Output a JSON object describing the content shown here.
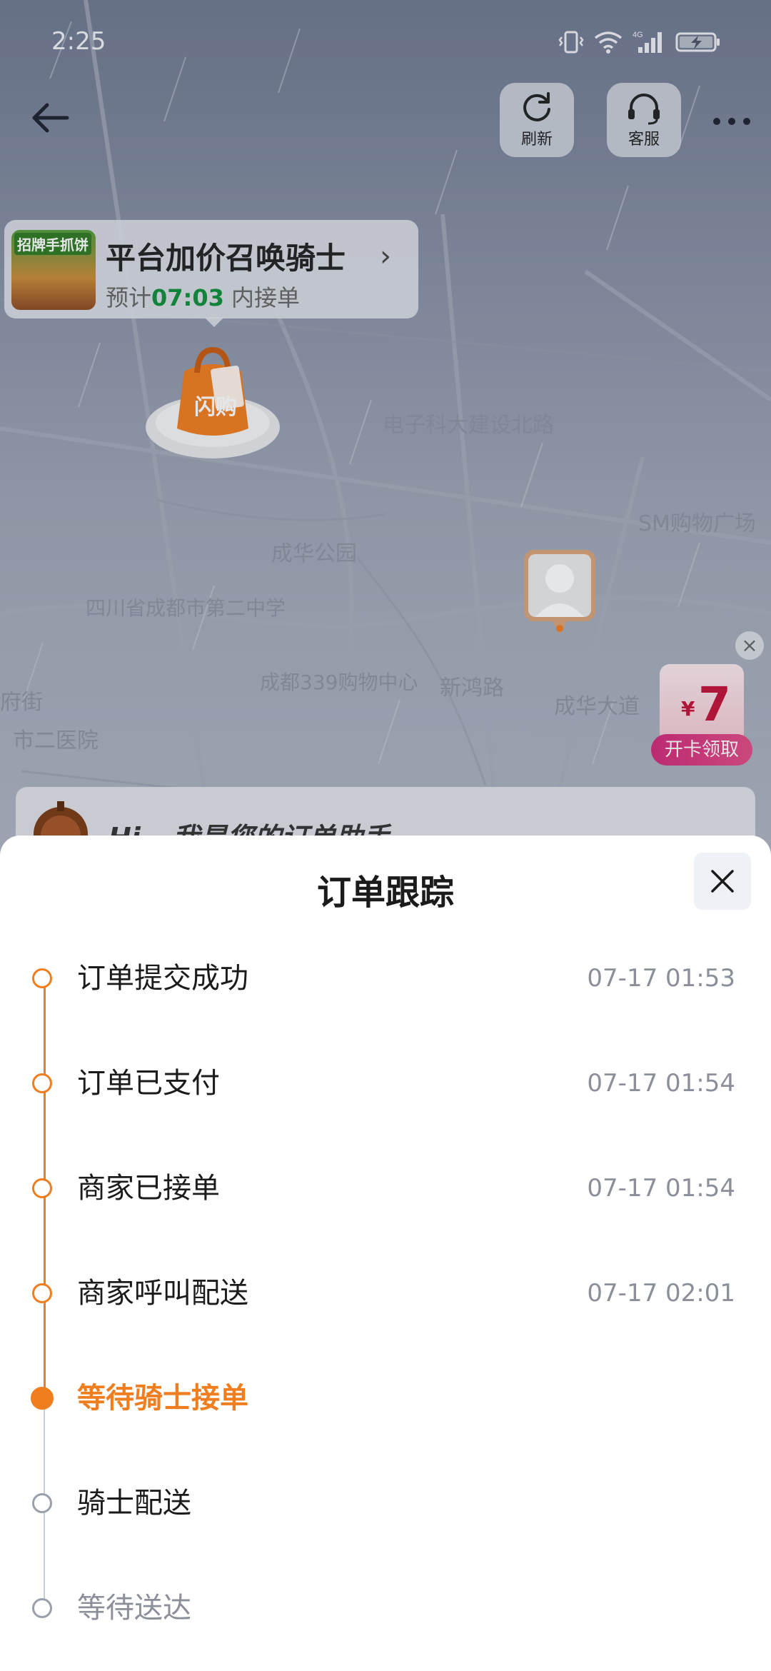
{
  "status_bar": {
    "time": "2:25",
    "network": "4G"
  },
  "toolbar": {
    "refresh_label": "刷新",
    "service_label": "客服"
  },
  "promo": {
    "thumb_text": "招牌手抓饼",
    "title": "平台加价召唤骑士",
    "sub_prefix": "预计",
    "eta": "07:03",
    "sub_suffix": "内接单"
  },
  "shop_marker_text": "闪购",
  "map_labels": [
    "电子科大建设北路",
    "成华公园",
    "四川省成都市第二中学",
    "成都339购物中心",
    "新鸿路",
    "成华大道",
    "SM购物广场",
    "市二医院",
    "府街"
  ],
  "coupon": {
    "currency": "¥",
    "value": "7",
    "button": "开卡领取",
    "close": "×"
  },
  "assistant": {
    "text": "Hi~ 我是您的订单助手"
  },
  "sheet": {
    "title": "订单跟踪",
    "steps": [
      {
        "label": "订单提交成功",
        "time": "07-17 01:53",
        "state": "done"
      },
      {
        "label": "订单已支付",
        "time": "07-17 01:54",
        "state": "done"
      },
      {
        "label": "商家已接单",
        "time": "07-17 01:54",
        "state": "done"
      },
      {
        "label": "商家呼叫配送",
        "time": "07-17 02:01",
        "state": "done"
      },
      {
        "label": "等待骑士接单",
        "time": "",
        "state": "current"
      },
      {
        "label": "骑士配送",
        "time": "",
        "state": "pending"
      },
      {
        "label": "等待送达",
        "time": "",
        "state": "pending-faded"
      }
    ]
  },
  "colors": {
    "accent": "#f07d1e",
    "pending": "#9aa0ab",
    "eta_green": "#0f8f3c"
  }
}
